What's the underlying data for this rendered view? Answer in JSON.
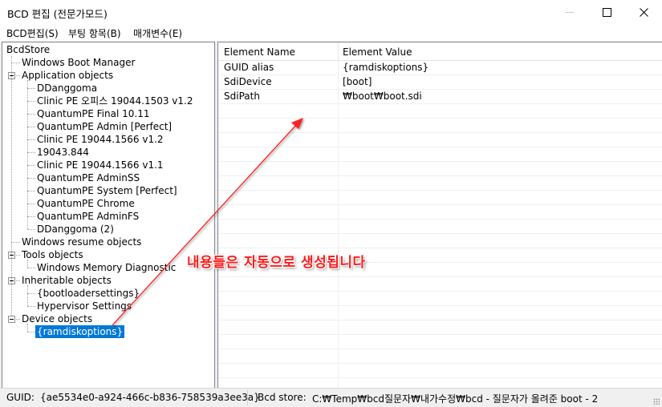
{
  "window": {
    "title": "BCD 편집 (전문가모드)",
    "minimize_label": "—",
    "maximize_label": "☐",
    "close_label": "✕"
  },
  "menu": [
    "BCD편집(S)",
    "부팅 항목(B)",
    "매개변수(E)"
  ],
  "tree": {
    "root": "BcdStore",
    "nodes": [
      {
        "label": "Windows Boot Manager"
      },
      {
        "label": "Application objects",
        "expanded": true
      },
      {
        "label": "DDanggoma"
      },
      {
        "label": "Clinic PE 오피스 19044.1503 v1.2"
      },
      {
        "label": "QuantumPE Final 10.11"
      },
      {
        "label": "QuantumPE Admin [Perfect]"
      },
      {
        "label": "Clinic PE 19044.1566 v1.2"
      },
      {
        "label": "19043.844"
      },
      {
        "label": "Clinic PE 19044.1566 v1.1"
      },
      {
        "label": "QuantumPE AdminSS"
      },
      {
        "label": "QuantumPE System [Perfect]"
      },
      {
        "label": "QuantumPE Chrome"
      },
      {
        "label": "QuantumPE AdminFS"
      },
      {
        "label": "DDanggoma (2)"
      },
      {
        "label": "Windows resume objects"
      },
      {
        "label": "Tools objects",
        "expanded": true
      },
      {
        "label": "Windows Memory Diagnostic"
      },
      {
        "label": "Inheritable objects",
        "expanded": true
      },
      {
        "label": "{bootloadersettings}"
      },
      {
        "label": "Hypervisor Settings"
      },
      {
        "label": "Device objects",
        "expanded": true
      },
      {
        "label": "{ramdiskoptions}",
        "selected": true
      }
    ]
  },
  "list": {
    "columns": [
      "Element Name",
      "Element Value"
    ],
    "rows": [
      [
        "GUID alias",
        "{ramdiskoptions}"
      ],
      [
        "SdiDevice",
        "[boot]"
      ],
      [
        "SdiPath",
        "₩boot₩boot.sdi"
      ]
    ]
  },
  "annotation": {
    "text": "내용들은 자동으로 생성됩니다",
    "color": "#ff1a1a"
  },
  "status": {
    "guid_label": "GUID:",
    "guid_value": "{ae5534e0-a924-466c-b836-758539a3ee3a}",
    "store_label": "Bcd store:",
    "store_value": "C:₩Temp₩bcd질문자₩내가수정₩bcd - 질문자가 올려준 boot - 2"
  },
  "colors": {
    "selection": "#0078d7",
    "arrow": "#ff2020"
  }
}
